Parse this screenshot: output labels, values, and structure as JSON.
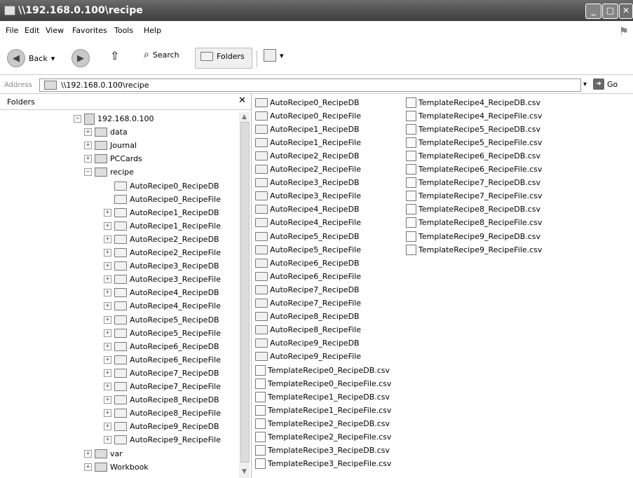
{
  "window": {
    "title": "\\\\192.168.0.100\\recipe"
  },
  "menu": [
    "File",
    "Edit",
    "View",
    "Favorites",
    "Tools",
    "Help"
  ],
  "toolbar": {
    "back": "Back",
    "search": "Search",
    "folders": "Folders"
  },
  "address": {
    "label": "Address",
    "value": "\\\\192.168.0.100\\recipe",
    "go": "Go"
  },
  "folders_pane": {
    "title": "Folders",
    "tree": {
      "host": "192.168.0.100",
      "top_items": [
        "data",
        "Journal",
        "PCCards"
      ],
      "recipe": "recipe",
      "recipe_children": [
        "AutoRecipe0_RecipeDB",
        "AutoRecipe0_RecipeFile",
        "AutoRecipe1_RecipeDB",
        "AutoRecipe1_RecipeFile",
        "AutoRecipe2_RecipeDB",
        "AutoRecipe2_RecipeFile",
        "AutoRecipe3_RecipeDB",
        "AutoRecipe3_RecipeFile",
        "AutoRecipe4_RecipeDB",
        "AutoRecipe4_RecipeFile",
        "AutoRecipe5_RecipeDB",
        "AutoRecipe5_RecipeFile",
        "AutoRecipe6_RecipeDB",
        "AutoRecipe6_RecipeFile",
        "AutoRecipe7_RecipeDB",
        "AutoRecipe7_RecipeFile",
        "AutoRecipe8_RecipeDB",
        "AutoRecipe8_RecipeFile",
        "AutoRecipe9_RecipeDB",
        "AutoRecipe9_RecipeFile"
      ],
      "bottom_items": [
        "var",
        "Workbook"
      ]
    }
  },
  "content": {
    "column1": [
      {
        "name": "AutoRecipe0_RecipeDB",
        "icon": "folder-icon"
      },
      {
        "name": "AutoRecipe0_RecipeFile",
        "icon": "folder-icon"
      },
      {
        "name": "AutoRecipe1_RecipeDB",
        "icon": "folder-icon"
      },
      {
        "name": "AutoRecipe1_RecipeFile",
        "icon": "folder-icon"
      },
      {
        "name": "AutoRecipe2_RecipeDB",
        "icon": "folder-icon"
      },
      {
        "name": "AutoRecipe2_RecipeFile",
        "icon": "folder-icon"
      },
      {
        "name": "AutoRecipe3_RecipeDB",
        "icon": "folder-icon"
      },
      {
        "name": "AutoRecipe3_RecipeFile",
        "icon": "folder-icon"
      },
      {
        "name": "AutoRecipe4_RecipeDB",
        "icon": "folder-icon"
      },
      {
        "name": "AutoRecipe4_RecipeFile",
        "icon": "folder-icon"
      },
      {
        "name": "AutoRecipe5_RecipeDB",
        "icon": "folder-icon"
      },
      {
        "name": "AutoRecipe5_RecipeFile",
        "icon": "folder-icon"
      },
      {
        "name": "AutoRecipe6_RecipeDB",
        "icon": "folder-icon"
      },
      {
        "name": "AutoRecipe6_RecipeFile",
        "icon": "folder-icon"
      },
      {
        "name": "AutoRecipe7_RecipeDB",
        "icon": "folder-icon"
      },
      {
        "name": "AutoRecipe7_RecipeFile",
        "icon": "folder-icon"
      },
      {
        "name": "AutoRecipe8_RecipeDB",
        "icon": "folder-icon"
      },
      {
        "name": "AutoRecipe8_RecipeFile",
        "icon": "folder-icon"
      },
      {
        "name": "AutoRecipe9_RecipeDB",
        "icon": "folder-icon"
      },
      {
        "name": "AutoRecipe9_RecipeFile",
        "icon": "folder-icon"
      },
      {
        "name": "TemplateRecipe0_RecipeDB.csv",
        "icon": "csv-file-icon"
      },
      {
        "name": "TemplateRecipe0_RecipeFile.csv",
        "icon": "csv-file-icon"
      },
      {
        "name": "TemplateRecipe1_RecipeDB.csv",
        "icon": "csv-file-icon"
      },
      {
        "name": "TemplateRecipe1_RecipeFile.csv",
        "icon": "csv-file-icon"
      },
      {
        "name": "TemplateRecipe2_RecipeDB.csv",
        "icon": "csv-file-icon"
      },
      {
        "name": "TemplateRecipe2_RecipeFile.csv",
        "icon": "csv-file-icon"
      },
      {
        "name": "TemplateRecipe3_RecipeDB.csv",
        "icon": "csv-file-icon"
      },
      {
        "name": "TemplateRecipe3_RecipeFile.csv",
        "icon": "csv-file-icon"
      }
    ],
    "column2": [
      {
        "name": "TemplateRecipe4_RecipeDB.csv",
        "icon": "csv-file-icon"
      },
      {
        "name": "TemplateRecipe4_RecipeFile.csv",
        "icon": "csv-file-icon"
      },
      {
        "name": "TemplateRecipe5_RecipeDB.csv",
        "icon": "csv-file-icon"
      },
      {
        "name": "TemplateRecipe5_RecipeFile.csv",
        "icon": "csv-file-icon"
      },
      {
        "name": "TemplateRecipe6_RecipeDB.csv",
        "icon": "csv-file-icon"
      },
      {
        "name": "TemplateRecipe6_RecipeFile.csv",
        "icon": "csv-file-icon"
      },
      {
        "name": "TemplateRecipe7_RecipeDB.csv",
        "icon": "csv-file-icon"
      },
      {
        "name": "TemplateRecipe7_RecipeFile.csv",
        "icon": "csv-file-icon"
      },
      {
        "name": "TemplateRecipe8_RecipeDB.csv",
        "icon": "csv-file-icon"
      },
      {
        "name": "TemplateRecipe8_RecipeFile.csv",
        "icon": "csv-file-icon"
      },
      {
        "name": "TemplateRecipe9_RecipeDB.csv",
        "icon": "csv-file-icon"
      },
      {
        "name": "TemplateRecipe9_RecipeFile.csv",
        "icon": "csv-file-icon"
      }
    ]
  }
}
